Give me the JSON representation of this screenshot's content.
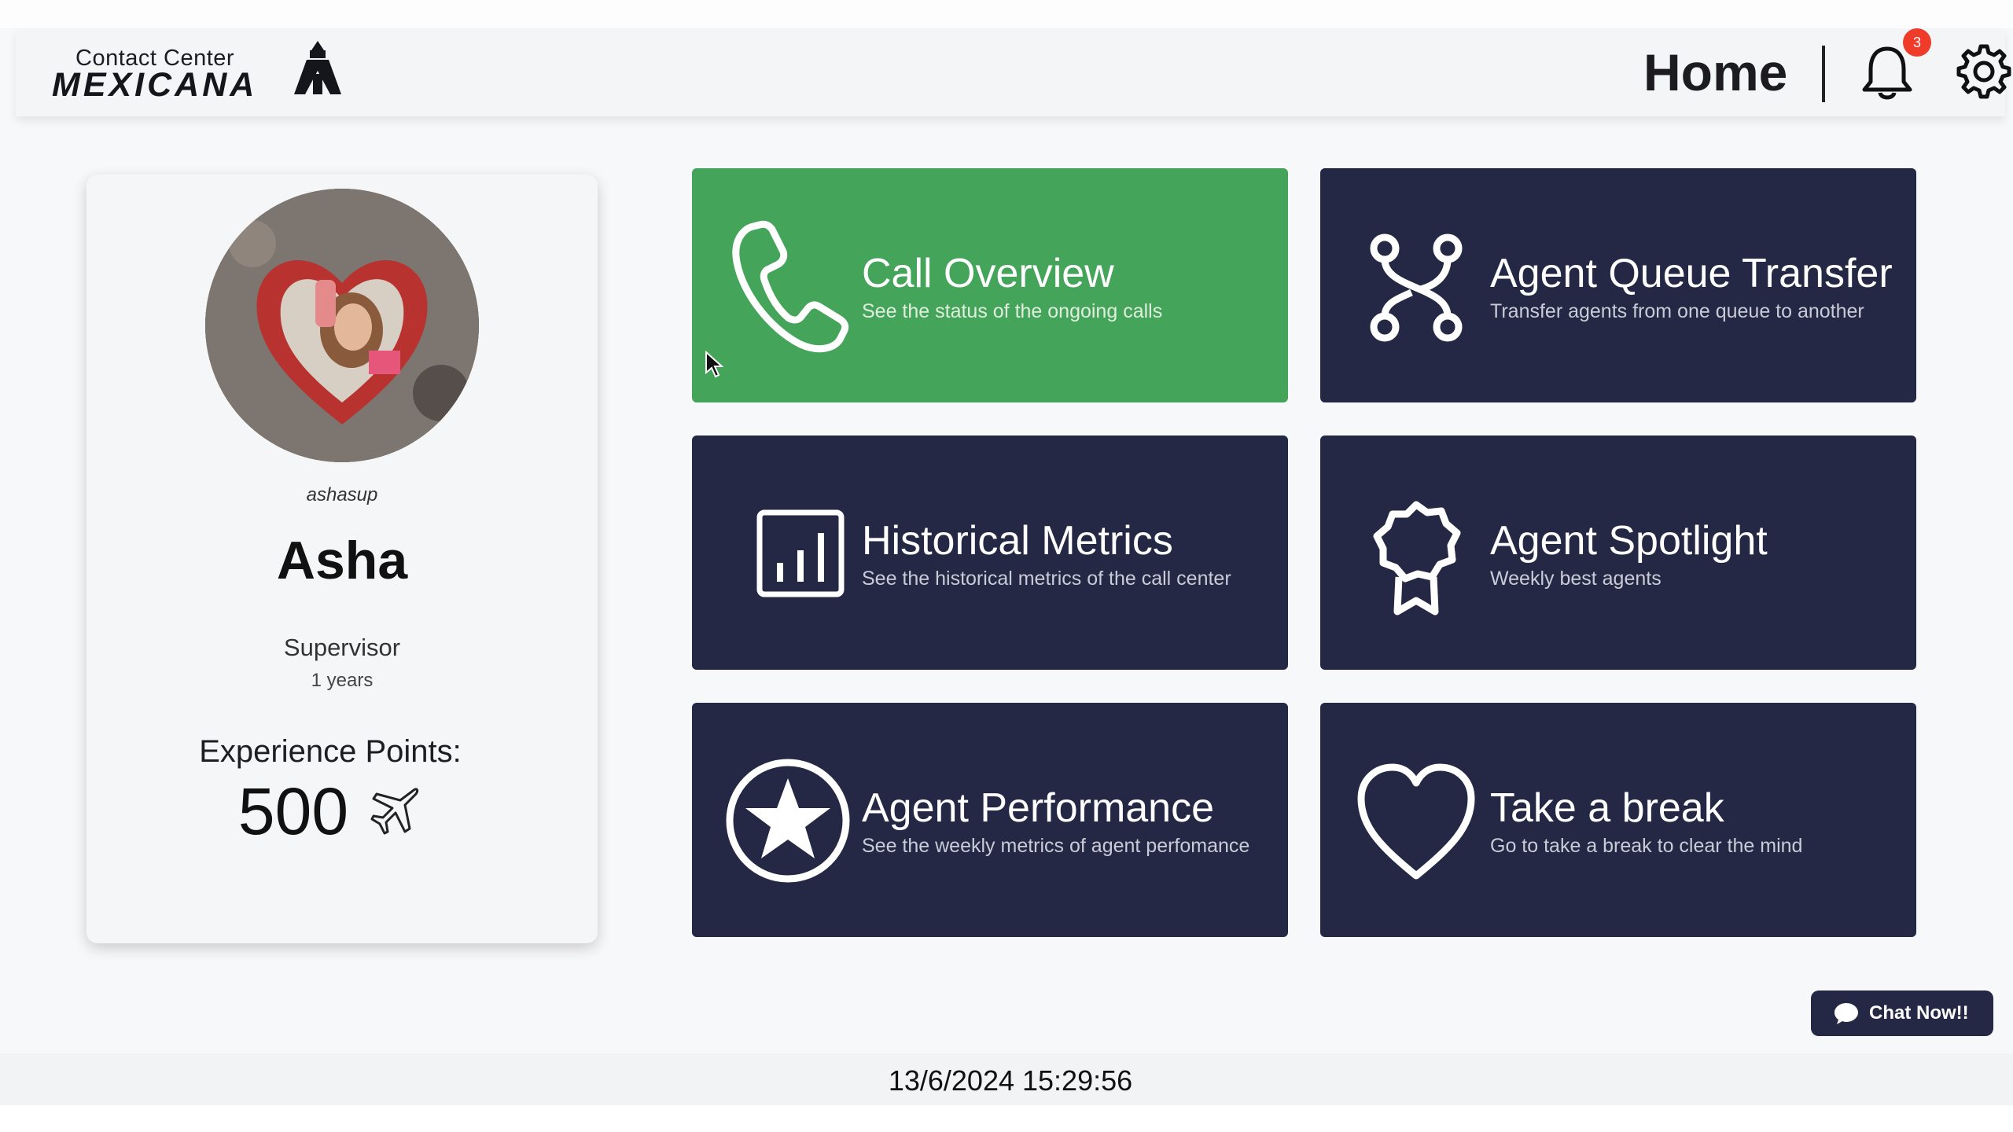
{
  "app": {
    "logo_top": "Contact Center",
    "logo_bottom": "MEXICANA",
    "page_title": "Home",
    "notification_count": "3"
  },
  "profile": {
    "username": "ashasup",
    "name": "Asha",
    "role": "Supervisor",
    "tenure": "1 years",
    "xp_label": "Experience Points:",
    "xp_value": "500"
  },
  "tiles": [
    {
      "title": "Call Overview",
      "subtitle": "See the status of the ongoing calls",
      "icon": "phone-icon",
      "active": true
    },
    {
      "title": "Agent Queue Transfer",
      "subtitle": "Transfer agents from one queue to another",
      "icon": "route-icon",
      "active": false
    },
    {
      "title": "Historical Metrics",
      "subtitle": "See the historical metrics of the call center",
      "icon": "bar-chart-icon",
      "active": false
    },
    {
      "title": "Agent Spotlight",
      "subtitle": "Weekly best agents",
      "icon": "award-icon",
      "active": false
    },
    {
      "title": "Agent Performance",
      "subtitle": "See the weekly metrics of agent perfomance",
      "icon": "star-icon",
      "active": false
    },
    {
      "title": "Take a break",
      "subtitle": "Go to take a break to clear the mind",
      "icon": "heart-icon",
      "active": false
    }
  ],
  "chat": {
    "label": "Chat Now!!"
  },
  "footer": {
    "datetime": "13/6/2024 15:29:56"
  },
  "colors": {
    "tile_dark": "#252844",
    "tile_active": "#44a459",
    "badge": "#ee3b2a"
  }
}
